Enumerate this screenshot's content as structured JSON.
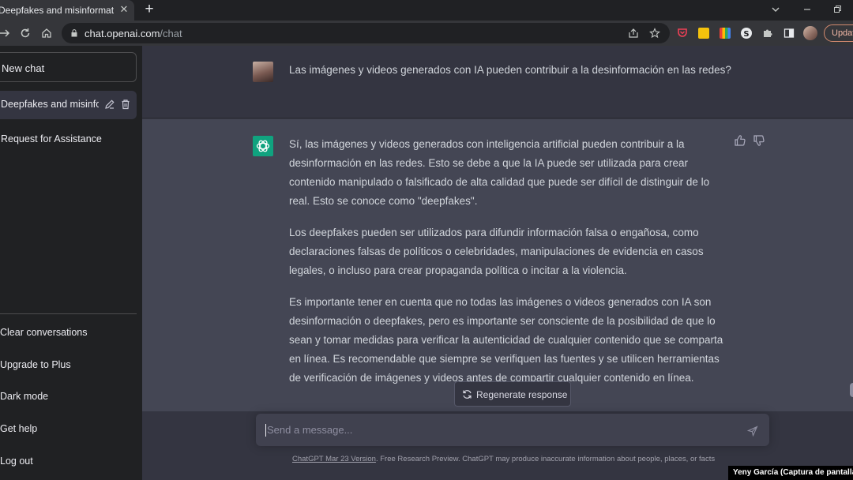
{
  "browser": {
    "tab_title": "Deepfakes and misinformation.",
    "tab_close": "✕",
    "new_tab": "+",
    "url_host": "chat.openai.com",
    "url_path": "/chat",
    "update_label": "Updat"
  },
  "sidebar": {
    "new_chat": "New chat",
    "conversations": [
      {
        "label": "Deepfakes and misinfor",
        "active": true
      },
      {
        "label": "Request for Assistance",
        "active": false
      }
    ],
    "links": [
      "Clear conversations",
      "Upgrade to Plus",
      "Dark mode",
      "Get help",
      "Log out"
    ]
  },
  "chat": {
    "user_question": "Las imágenes y videos generados con IA pueden contribuir a la desinformación en las redes?",
    "answer_paragraphs": [
      "Sí, las imágenes y videos generados con inteligencia artificial pueden contribuir a la desinformación en las redes. Esto se debe a que la IA puede ser utilizada para crear contenido manipulado o falsificado de alta calidad que puede ser difícil de distinguir de lo real. Esto se conoce como \"deepfakes\".",
      "Los deepfakes pueden ser utilizados para difundir información falsa o engañosa, como declaraciones falsas de políticos o celebridades, manipulaciones de evidencia en casos legales, o incluso para crear propaganda política o incitar a la violencia.",
      "Es importante tener en cuenta que no todas las imágenes o videos generados con IA son desinformación o deepfakes, pero es importante ser consciente de la posibilidad de que lo sean y tomar medidas para verificar la autenticidad de cualquier contenido que se comparta en línea. Es recomendable que siempre se verifiquen las fuentes y se utilicen herramientas de verificación de imágenes y videos antes de compartir cualquier contenido en línea."
    ],
    "regenerate_label": "Regenerate response",
    "input_placeholder": "Send a message...",
    "footer_link": "ChatGPT Mar 23 Version",
    "footer_text": ". Free Research Preview. ChatGPT may produce inaccurate information about people, places, or facts"
  },
  "credit": "Yeny García (Captura de pantalla)",
  "colors": {
    "sidebar_bg": "#202123",
    "main_bg": "#343541",
    "answer_bg": "#444654",
    "brand_green": "#10a37f",
    "input_bg": "#40414f"
  }
}
